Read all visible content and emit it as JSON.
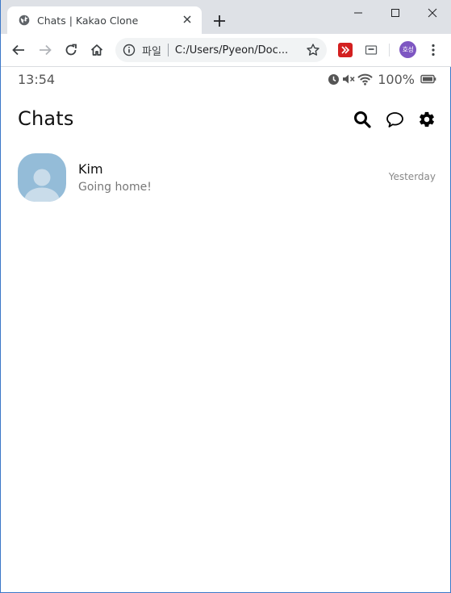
{
  "browser": {
    "tab_title": "Chats | Kakao Clone",
    "omnibox": {
      "scheme_label": "파일",
      "url": "C:/Users/Pyeon/Doc..."
    },
    "profile_initials": "호성"
  },
  "statusbar": {
    "time": "13:54",
    "battery": "100%"
  },
  "header": {
    "title": "Chats"
  },
  "chats": [
    {
      "name": "Kim",
      "preview": "Going home!",
      "time": "Yesterday"
    }
  ],
  "colors": {
    "avatar_bg": "#94bcd8",
    "profile_bg": "#7e57c2",
    "extension_red": "#d32020"
  }
}
